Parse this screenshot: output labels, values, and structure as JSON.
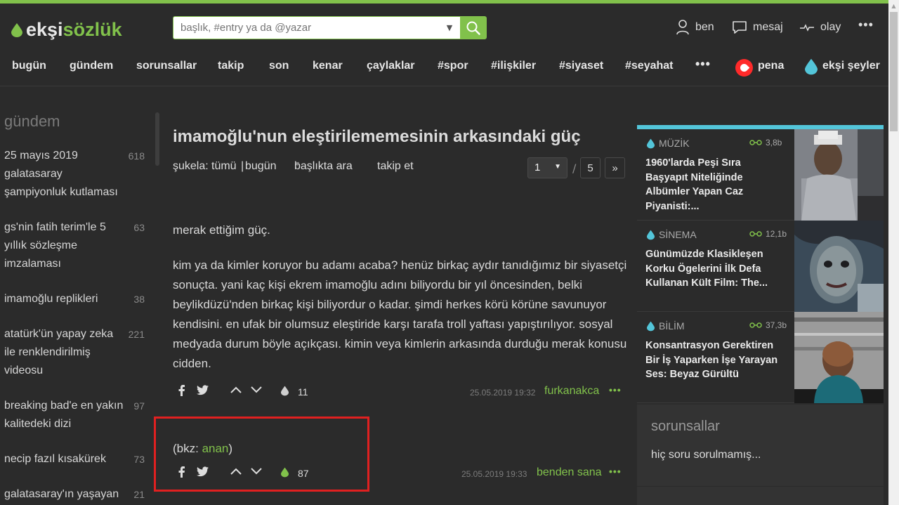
{
  "header": {
    "logo_part1": "ekşi",
    "logo_part2": "sözlük",
    "search_placeholder": "başlık, #entry ya da @yazar",
    "user_links": [
      {
        "label": "ben",
        "icon": "user-icon"
      },
      {
        "label": "mesaj",
        "icon": "message-icon"
      },
      {
        "label": "olay",
        "icon": "events-icon"
      }
    ]
  },
  "nav": {
    "items": [
      "bugün",
      "gündem",
      "sorunsallar",
      "takip",
      "son",
      "kenar",
      "çaylaklar",
      "#spor",
      "#ilişkiler",
      "#siyaset",
      "#seyahat"
    ],
    "more": "•••",
    "pena": "pena",
    "eksi_seyler": "ekşi şeyler"
  },
  "sidebar": {
    "heading": "gündem",
    "topics": [
      {
        "title": "25 mayıs 2019 galatasaray şampiyonluk kutlaması",
        "count": "618"
      },
      {
        "title": "gs'nin fatih terim'le 5 yıllık sözleşme imzalaması",
        "count": "63"
      },
      {
        "title": "imamoğlu replikleri",
        "count": "38"
      },
      {
        "title": "atatürk'ün yapay zeka ile renklendirilmiş videosu",
        "count": "221"
      },
      {
        "title": "breaking bad'e en yakın kalitedeki dizi",
        "count": "97"
      },
      {
        "title": "necip fazıl kısakürek",
        "count": "73"
      },
      {
        "title": "galatasaray'ın yaşayan",
        "count": "21"
      }
    ]
  },
  "main": {
    "title": "imamoğlu'nun eleştirilememesinin arkasındaki güç",
    "sukela_label": "şukela:",
    "sukela_all": "tümü",
    "sukela_sep": "|",
    "sukela_today": "bugün",
    "search_in_title": "başlıkta ara",
    "follow": "takip et",
    "pager_current": "1",
    "pager_sep": "/",
    "pager_total": "5",
    "pager_next": "»",
    "entries": [
      {
        "paragraph1": "merak ettiğim güç.",
        "paragraph2": "kim ya da kimler koruyor bu adamı acaba? henüz birkaç aydır tanıdığımız bir siyasetçi sonuçta. yani kaç kişi ekrem imamoğlu adını biliyordu bir yıl öncesinden, belki beylikdüzü'nden birkaç kişi biliyordur o kadar. şimdi herkes körü körüne savunuyor kendisini. en ufak bir olumsuz eleştiride karşı tarafa troll yaftası yapıştırılıyor. sosyal medyada durum böyle açıkçası. kimin veya kimlerin arkasında durduğu merak konusu cidden.",
        "fav_count": "11",
        "date": "25.05.2019 19:32",
        "author": "furkanakca"
      },
      {
        "bkz_prefix": "(bkz: ",
        "bkz_link": "anan",
        "bkz_suffix": ")",
        "fav_count": "87",
        "date": "25.05.2019 19:33",
        "author": "benden sana"
      }
    ]
  },
  "right": {
    "cards": [
      {
        "category": "MÜZİK",
        "views": "3,8b",
        "title": "1960'larda Peşi Sıra Başyapıt Niteliğinde Albümler Yapan Caz Piyanisti:..."
      },
      {
        "category": "SİNEMA",
        "views": "12,1b",
        "title": "Günümüzde Klasikleşen Korku Ögelerini İlk Defa Kullanan Kült Film: The..."
      },
      {
        "category": "BİLİM",
        "views": "37,3b",
        "title": "Konsantrasyon Gerektiren Bir İş Yaparken İşe Yarayan Ses: Beyaz Gürültü"
      }
    ],
    "sorunsallar_heading": "sorunsallar",
    "sorunsallar_text": "hiç soru sorulmamış..."
  },
  "colors": {
    "brand_green": "#81c14b",
    "background": "#2b2b2b",
    "card_accent": "#53c5d9",
    "highlight_red": "#e02020"
  }
}
